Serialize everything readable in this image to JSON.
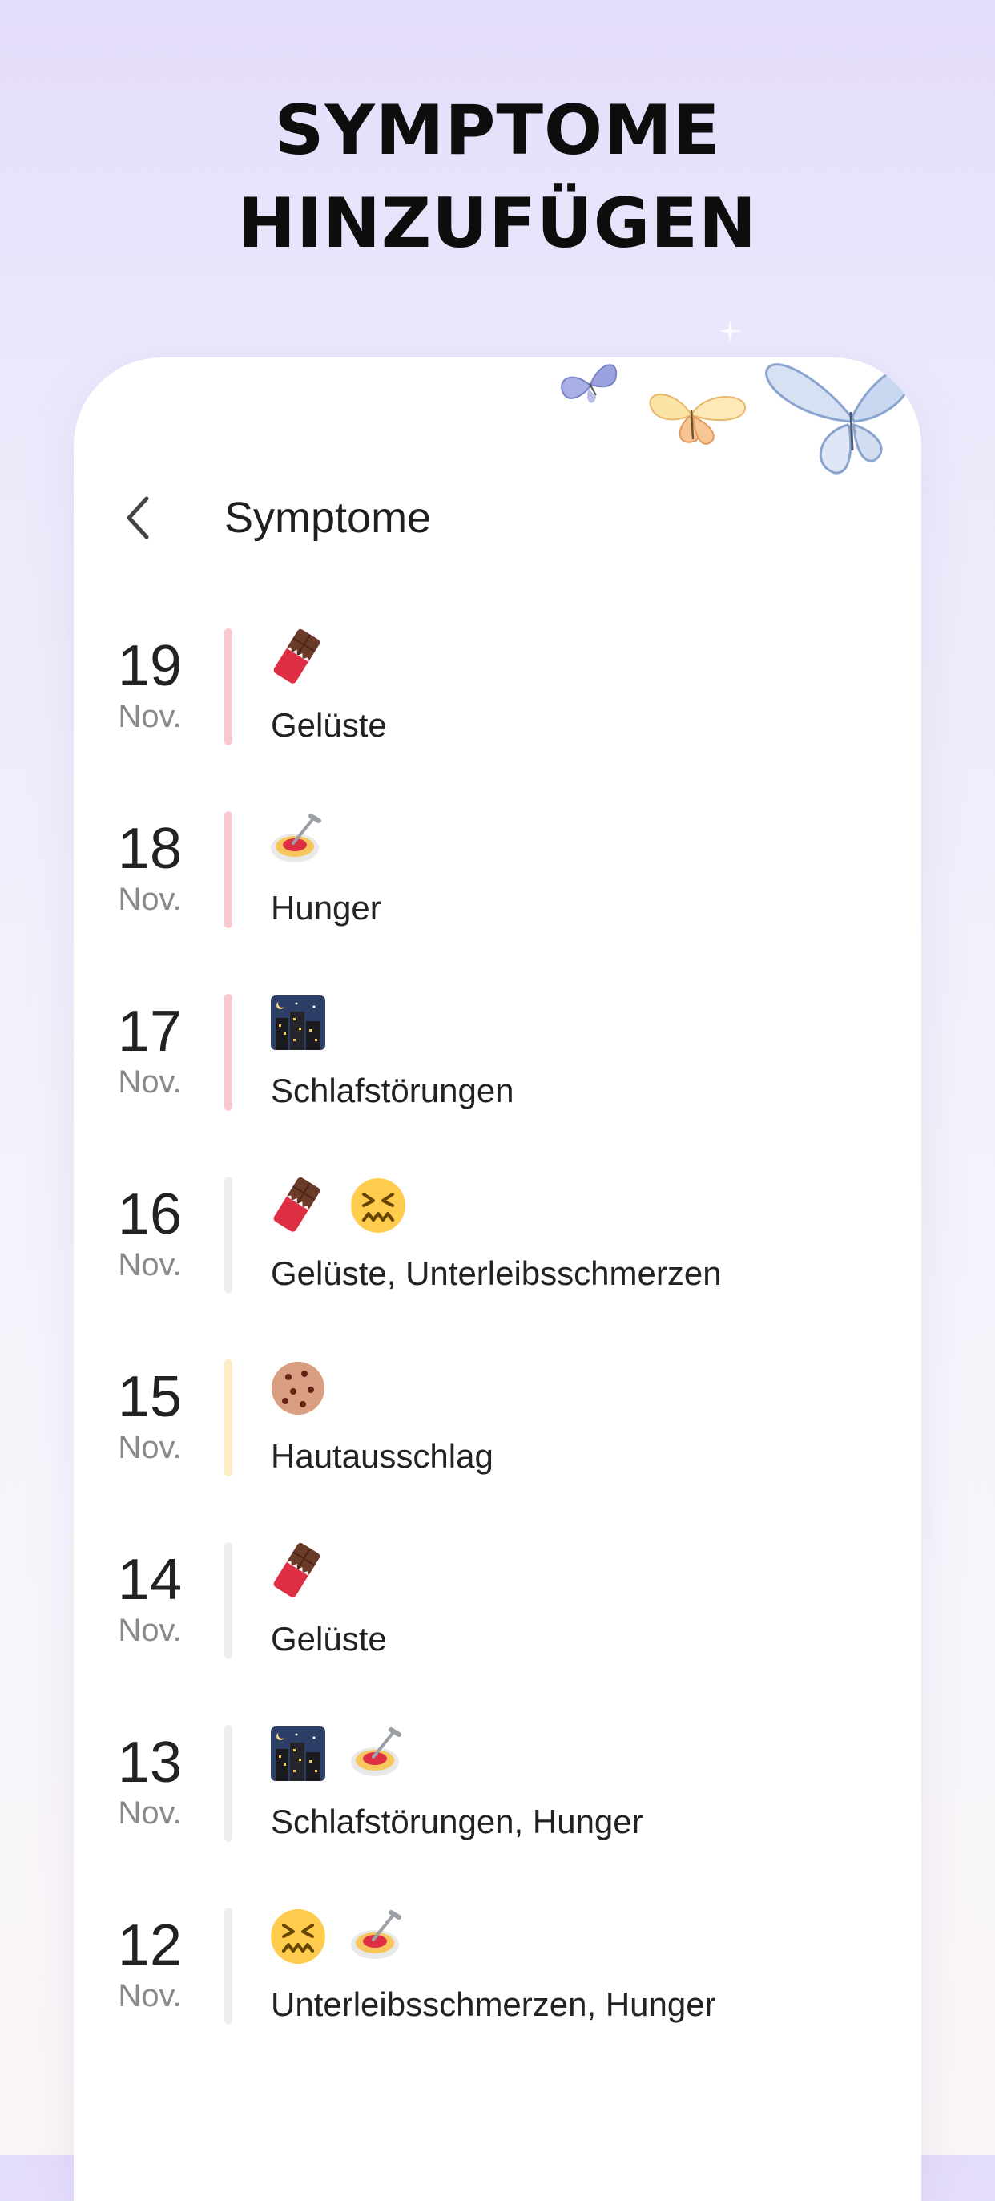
{
  "headline": {
    "line1": "SYMPTOME",
    "line2": "HINZUFÜGEN"
  },
  "header": {
    "back_icon": "chevron-left-icon",
    "title": "Symptome"
  },
  "colors": {
    "bar_red": "#f9c9cd",
    "bar_grey": "#eeeeee",
    "bar_yellow": "#fdecc4"
  },
  "entries": [
    {
      "day": "19",
      "month": "Nov.",
      "bar": "red",
      "icons": [
        "chocolate-bar-icon"
      ],
      "label": "Gelüste"
    },
    {
      "day": "18",
      "month": "Nov.",
      "bar": "red",
      "icons": [
        "spaghetti-icon"
      ],
      "label": "Hunger"
    },
    {
      "day": "17",
      "month": "Nov.",
      "bar": "red",
      "icons": [
        "night-city-icon"
      ],
      "label": "Schlafstörungen"
    },
    {
      "day": "16",
      "month": "Nov.",
      "bar": "grey",
      "icons": [
        "chocolate-bar-icon",
        "confounded-face-icon"
      ],
      "label": "Gelüste, Unterleibsschmerzen"
    },
    {
      "day": "15",
      "month": "Nov.",
      "bar": "yellow",
      "icons": [
        "cookie-icon"
      ],
      "label": "Hautausschlag"
    },
    {
      "day": "14",
      "month": "Nov.",
      "bar": "grey",
      "icons": [
        "chocolate-bar-icon"
      ],
      "label": "Gelüste"
    },
    {
      "day": "13",
      "month": "Nov.",
      "bar": "grey",
      "icons": [
        "night-city-icon",
        "spaghetti-icon"
      ],
      "label": "Schlafstörungen, Hunger"
    },
    {
      "day": "12",
      "month": "Nov.",
      "bar": "grey",
      "icons": [
        "confounded-face-icon",
        "spaghetti-icon"
      ],
      "label": "Unterleibsschmerzen, Hunger"
    }
  ]
}
